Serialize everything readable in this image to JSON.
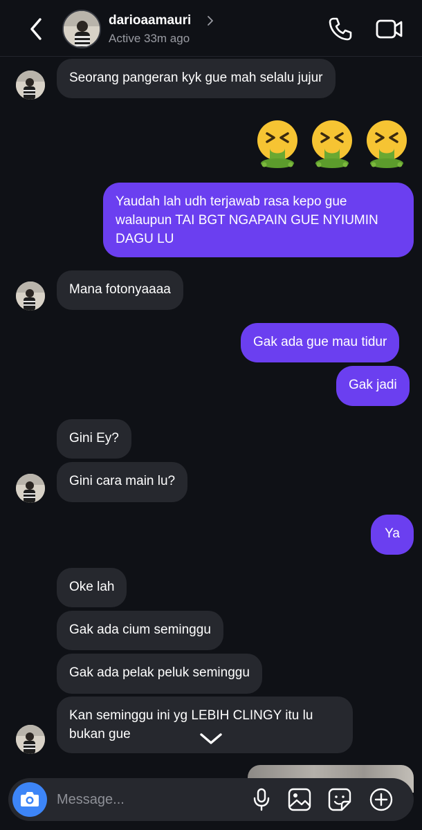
{
  "header": {
    "username": "darioaamauri",
    "status": "Active 33m ago"
  },
  "icons": {
    "back": "chevron-left-icon",
    "profile_chevron": "chevron-right-icon",
    "call": "phone-icon",
    "video": "video-camera-icon",
    "scroll": "chevron-down-icon",
    "camera": "camera-icon",
    "mic": "microphone-icon",
    "gallery": "image-icon",
    "sticker": "sticker-icon",
    "add": "plus-circle-icon"
  },
  "messages": [
    {
      "side": "in",
      "text": "Seorang pangeran kyk gue mah selalu jujur"
    },
    {
      "side": "out",
      "type": "emoji",
      "text": "🤮🤮🤮"
    },
    {
      "side": "out",
      "text": "Yaudah lah udh terjawab rasa kepo gue walaupun TAI BGT NGAPAIN GUE NYIUMIN DAGU LU"
    },
    {
      "side": "in",
      "text": "Mana fotonyaaaa"
    },
    {
      "side": "out",
      "text": "Gak ada gue mau tidur"
    },
    {
      "side": "out",
      "text": "Gak jadi"
    },
    {
      "side": "in",
      "text": "Gini Ey?"
    },
    {
      "side": "in",
      "text": "Gini cara main lu?"
    },
    {
      "side": "out",
      "text": "Ya"
    },
    {
      "side": "in",
      "text": "Oke lah"
    },
    {
      "side": "in",
      "text": "Gak ada cium seminggu"
    },
    {
      "side": "in",
      "text": "Gak ada pelak peluk seminggu"
    },
    {
      "side": "in",
      "text": "Kan seminggu ini yg LEBIH CLINGY itu lu bukan gue"
    }
  ],
  "composer": {
    "placeholder": "Message..."
  },
  "colors": {
    "background": "#0f1116",
    "incoming_bubble": "#26282e",
    "outgoing_bubble": "#6b3ff0",
    "camera_button": "#3d85f7",
    "secondary_text": "#9a9ca3"
  }
}
